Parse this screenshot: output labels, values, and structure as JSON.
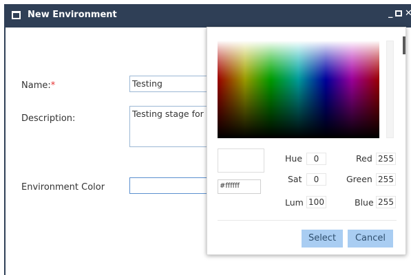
{
  "window": {
    "title": "New Environment",
    "min_glyph": "_",
    "close_glyph": "✕"
  },
  "form": {
    "name_label": "Name:",
    "required_mark": "*",
    "name_value": "Testing",
    "description_label": "Description:",
    "description_value": "Testing stage for th",
    "env_color_label": "Environment Color",
    "env_color_value": ""
  },
  "color_picker": {
    "hex_value": "#ffffff",
    "preview_color": "#ffffff",
    "hue_label": "Hue",
    "hue_value": "0",
    "sat_label": "Sat",
    "sat_value": "0",
    "lum_label": "Lum",
    "lum_value": "100",
    "red_label": "Red",
    "red_value": "255",
    "green_label": "Green",
    "green_value": "255",
    "blue_label": "Blue",
    "blue_value": "255",
    "select_label": "Select",
    "cancel_label": "Cancel"
  },
  "colors": {
    "titlebar": "#2f3f56",
    "button_bg": "#a9cdf2",
    "required": "#e53030"
  }
}
